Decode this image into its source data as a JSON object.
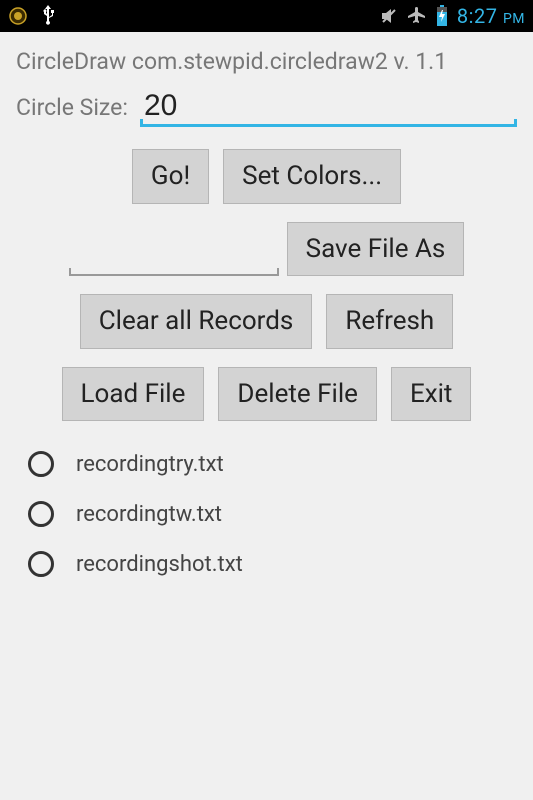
{
  "status_bar": {
    "time": "8:27",
    "time_suffix": "PM"
  },
  "app": {
    "title": "CircleDraw com.stewpid.circledraw2 v. 1.1"
  },
  "circle_size": {
    "label": "Circle Size:",
    "value": "20"
  },
  "filename": {
    "value": ""
  },
  "buttons": {
    "go": "Go!",
    "set_colors": "Set Colors...",
    "save_as": "Save File As",
    "clear": "Clear all Records",
    "refresh": "Refresh",
    "load": "Load File",
    "delete": "Delete File",
    "exit": "Exit"
  },
  "files": [
    {
      "name": "recordingtry.txt"
    },
    {
      "name": "recordingtw.txt"
    },
    {
      "name": "recordingshot.txt"
    }
  ]
}
